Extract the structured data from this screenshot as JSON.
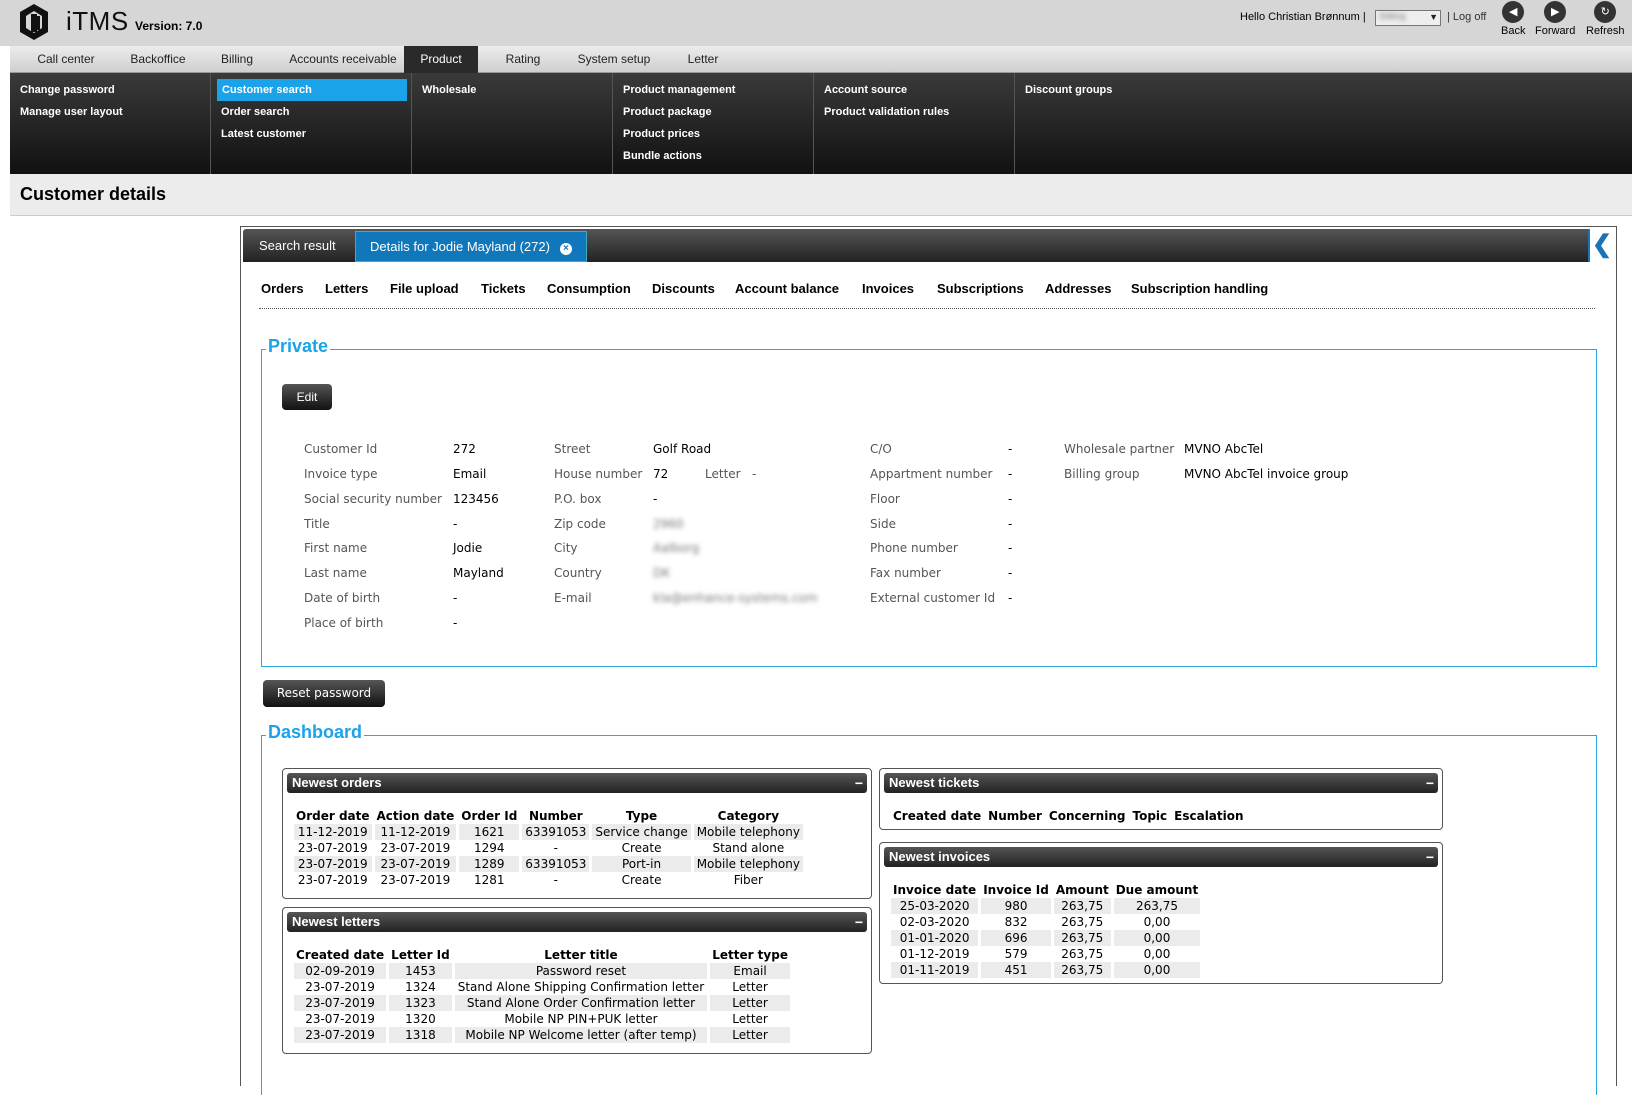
{
  "header": {
    "app_title": "iTMS",
    "version": "Version: 7.0",
    "greeting": "Hello Christian Brønnum",
    "separator": "|",
    "user_select_value": "Stilling",
    "logoff": "Log off",
    "nav": [
      {
        "label": "Back",
        "icon": "back-icon",
        "glyph": "◀"
      },
      {
        "label": "Forward",
        "icon": "forward-icon",
        "glyph": "▶"
      },
      {
        "label": "Refresh",
        "icon": "refresh-icon",
        "glyph": "↻"
      }
    ]
  },
  "menu": [
    "Call center",
    "Backoffice",
    "Billing",
    "Accounts receivable",
    "Product",
    "Rating",
    "System setup",
    "Letter"
  ],
  "menu_active": "Product",
  "submenu": {
    "col1": [
      "Change password",
      "Manage user layout"
    ],
    "col2": [
      "Customer search",
      "Order search",
      "Latest customer"
    ],
    "col3": [
      "Wholesale"
    ],
    "col4": [
      "Product management",
      "Product package",
      "Product prices",
      "Bundle actions"
    ],
    "col5": [
      "Account source",
      "Product validation rules"
    ],
    "col6": [
      "Discount groups"
    ]
  },
  "page_title": "Customer details",
  "tabs": {
    "search_result": "Search result",
    "details": "Details for Jodie Mayland (272)"
  },
  "subtabs": [
    "Orders",
    "Letters",
    "File upload",
    "Tickets",
    "Consumption",
    "Discounts",
    "Account balance",
    "Invoices",
    "Subscriptions",
    "Addresses",
    "Subscription handling"
  ],
  "private": {
    "legend": "Private",
    "edit_label": "Edit",
    "col1": [
      {
        "label": "Customer Id",
        "value": "272"
      },
      {
        "label": "Invoice type",
        "value": "Email"
      },
      {
        "label": "Social security number",
        "value": "123456"
      },
      {
        "label": "Title",
        "value": "-"
      },
      {
        "label": "First name",
        "value": "Jodie"
      },
      {
        "label": "Last name",
        "value": "Mayland"
      },
      {
        "label": "Date of birth",
        "value": "-"
      },
      {
        "label": "Place of birth",
        "value": "-"
      }
    ],
    "col2": [
      {
        "label": "Street",
        "value": "Golf Road"
      },
      {
        "label": "House number",
        "value": "72"
      },
      {
        "label": "P.O. box",
        "value": "-"
      },
      {
        "label": "Zip code",
        "value": "2960"
      },
      {
        "label": "City",
        "value": "Aalborg"
      },
      {
        "label": "Country",
        "value": "DK"
      },
      {
        "label": "E-mail",
        "value": "kla@enhance-systems.com"
      }
    ],
    "letter_label": "Letter",
    "letter_value": "-",
    "col3": [
      {
        "label": "C/O",
        "value": "-"
      },
      {
        "label": "Appartment number",
        "value": "-"
      },
      {
        "label": "Floor",
        "value": "-"
      },
      {
        "label": "Side",
        "value": "-"
      },
      {
        "label": "Phone number",
        "value": "-"
      },
      {
        "label": "Fax number",
        "value": "-"
      },
      {
        "label": "External customer Id",
        "value": "-"
      }
    ],
    "col4": [
      {
        "label": "Wholesale partner",
        "value": "MVNO AbcTel"
      },
      {
        "label": "Billing group",
        "value": "MVNO AbcTel invoice group"
      }
    ]
  },
  "reset_password_label": "Reset password",
  "dashboard": {
    "legend": "Dashboard",
    "orders": {
      "title": "Newest orders",
      "headers": [
        "Order date",
        "Action date",
        "Order Id",
        "Number",
        "Type",
        "Category"
      ],
      "rows": [
        [
          "11-12-2019",
          "11-12-2019",
          "1621",
          "63391053",
          "Service change",
          "Mobile telephony"
        ],
        [
          "23-07-2019",
          "23-07-2019",
          "1294",
          "-",
          "Create",
          "Stand alone"
        ],
        [
          "23-07-2019",
          "23-07-2019",
          "1289",
          "63391053",
          "Port-in",
          "Mobile telephony"
        ],
        [
          "23-07-2019",
          "23-07-2019",
          "1281",
          "-",
          "Create",
          "Fiber"
        ]
      ]
    },
    "letters": {
      "title": "Newest letters",
      "headers": [
        "Created date",
        "Letter Id",
        "Letter title",
        "Letter type"
      ],
      "rows": [
        [
          "02-09-2019",
          "1453",
          "Password reset",
          "Email"
        ],
        [
          "23-07-2019",
          "1324",
          "Stand Alone Shipping Confirmation letter",
          "Letter"
        ],
        [
          "23-07-2019",
          "1323",
          "Stand Alone Order Confirmation letter",
          "Letter"
        ],
        [
          "23-07-2019",
          "1320",
          "Mobile NP PIN+PUK letter",
          "Letter"
        ],
        [
          "23-07-2019",
          "1318",
          "Mobile NP Welcome letter (after temp)",
          "Letter"
        ]
      ]
    },
    "tickets": {
      "title": "Newest tickets",
      "headers": [
        "Created date",
        "Number",
        "Concerning",
        "Topic",
        "Escalation"
      ]
    },
    "invoices": {
      "title": "Newest invoices",
      "headers": [
        "Invoice date",
        "Invoice Id",
        "Amount",
        "Due amount"
      ],
      "rows": [
        [
          "25-03-2020",
          "980",
          "263,75",
          "263,75"
        ],
        [
          "02-03-2020",
          "832",
          "263,75",
          "0,00"
        ],
        [
          "01-01-2020",
          "696",
          "263,75",
          "0,00"
        ],
        [
          "01-12-2019",
          "579",
          "263,75",
          "0,00"
        ],
        [
          "01-11-2019",
          "451",
          "263,75",
          "0,00"
        ]
      ]
    },
    "minimize_glyph": "−"
  }
}
